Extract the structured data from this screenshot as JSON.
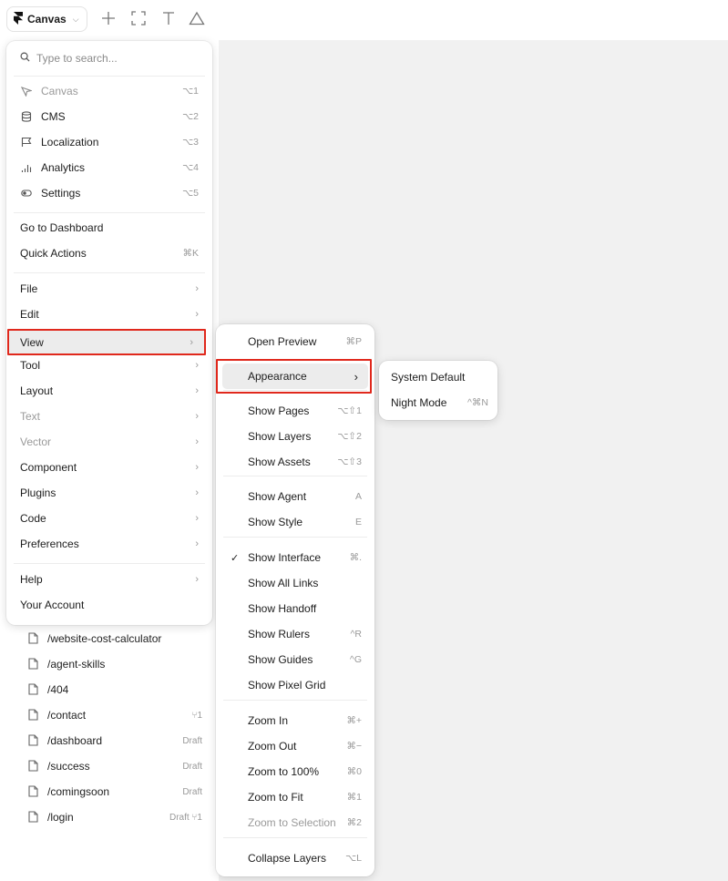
{
  "toolbar": {
    "canvas_label": "Canvas",
    "icons": [
      "framer-logo-icon",
      "plus-icon",
      "frame-icon",
      "text-icon",
      "triangle-icon"
    ]
  },
  "search": {
    "placeholder": "Type to search..."
  },
  "main_menu": {
    "modes": [
      {
        "label": "Canvas",
        "shortcut": "⌥1",
        "icon": "cursor-icon",
        "muted": true
      },
      {
        "label": "CMS",
        "shortcut": "⌥2",
        "icon": "database-icon",
        "muted": false
      },
      {
        "label": "Localization",
        "shortcut": "⌥3",
        "icon": "flag-icon",
        "muted": false
      },
      {
        "label": "Analytics",
        "shortcut": "⌥4",
        "icon": "bar-chart-icon",
        "muted": false
      },
      {
        "label": "Settings",
        "shortcut": "⌥5",
        "icon": "toggle-icon",
        "muted": false
      }
    ],
    "actions": [
      {
        "label": "Go to Dashboard",
        "shortcut": ""
      },
      {
        "label": "Quick Actions",
        "shortcut": "⌘K"
      }
    ],
    "submenus": [
      {
        "label": "File",
        "muted": false
      },
      {
        "label": "Edit",
        "muted": false
      },
      {
        "label": "View",
        "muted": false
      },
      {
        "label": "Tool",
        "muted": false
      },
      {
        "label": "Layout",
        "muted": false
      },
      {
        "label": "Text",
        "muted": true
      },
      {
        "label": "Vector",
        "muted": true
      },
      {
        "label": "Component",
        "muted": false
      },
      {
        "label": "Plugins",
        "muted": false
      },
      {
        "label": "Code",
        "muted": false
      },
      {
        "label": "Preferences",
        "muted": false
      }
    ],
    "help": "Help",
    "account": "Your Account",
    "arrow": "›"
  },
  "view_menu": {
    "items": [
      {
        "label": "Open Preview",
        "shortcut": "⌘P"
      },
      {
        "label": "Appearance",
        "shortcut": "›"
      },
      {
        "label": "Show Pages",
        "shortcut": "⌥⇧1"
      },
      {
        "label": "Show Layers",
        "shortcut": "⌥⇧2"
      },
      {
        "label": "Show Assets",
        "shortcut": "⌥⇧3"
      },
      {
        "label": "Show Agent",
        "shortcut": "A"
      },
      {
        "label": "Show Style",
        "shortcut": "E"
      },
      {
        "label": "Show Interface",
        "shortcut": "⌘.",
        "checked": true
      },
      {
        "label": "Show All Links",
        "shortcut": ""
      },
      {
        "label": "Show Handoff",
        "shortcut": ""
      },
      {
        "label": "Show Rulers",
        "shortcut": "^R"
      },
      {
        "label": "Show Guides",
        "shortcut": "^G"
      },
      {
        "label": "Show Pixel Grid",
        "shortcut": ""
      },
      {
        "label": "Zoom In",
        "shortcut": "⌘+"
      },
      {
        "label": "Zoom Out",
        "shortcut": "⌘−"
      },
      {
        "label": "Zoom to 100%",
        "shortcut": "⌘0"
      },
      {
        "label": "Zoom to Fit",
        "shortcut": "⌘1"
      },
      {
        "label": "Zoom to Selection",
        "shortcut": "⌘2",
        "muted": true
      },
      {
        "label": "Collapse Layers",
        "shortcut": "⌥L"
      }
    ],
    "check": "✓"
  },
  "appearance_menu": {
    "items": [
      {
        "label": "System Default",
        "shortcut": ""
      },
      {
        "label": "Night Mode",
        "shortcut": "^⌘N"
      }
    ]
  },
  "pages": [
    {
      "name": "/website-cost-calculator",
      "meta": ""
    },
    {
      "name": "/agent-skills",
      "meta": ""
    },
    {
      "name": "/404",
      "meta": ""
    },
    {
      "name": "/contact",
      "meta": "⑂1"
    },
    {
      "name": "/dashboard",
      "meta": "Draft"
    },
    {
      "name": "/success",
      "meta": "Draft"
    },
    {
      "name": "/comingsoon",
      "meta": "Draft"
    },
    {
      "name": "/login",
      "meta": "Draft ⑂1"
    }
  ]
}
